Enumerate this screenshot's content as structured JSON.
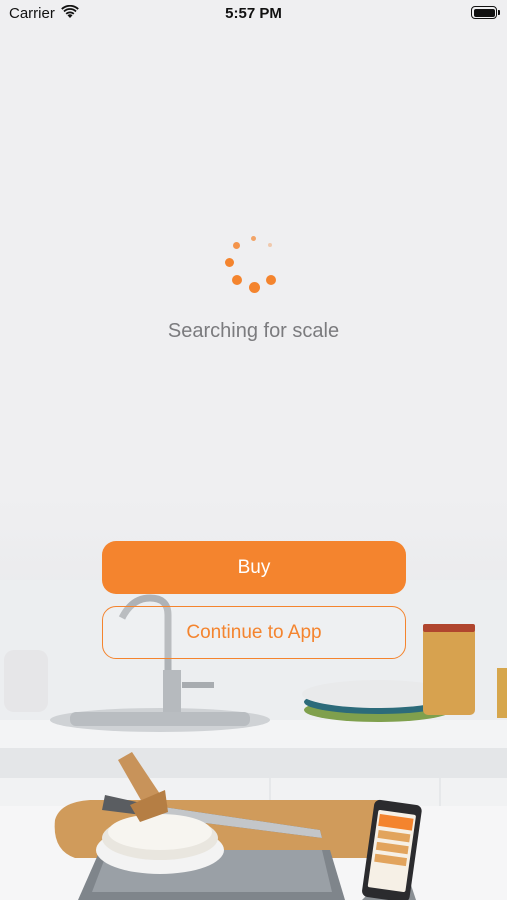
{
  "status_bar": {
    "carrier": "Carrier",
    "time": "5:57 PM",
    "icons": [
      "wifi-icon",
      "battery-icon"
    ]
  },
  "main": {
    "status_text": "Searching for scale",
    "spinner": "loading-spinner"
  },
  "actions": {
    "buy_label": "Buy",
    "continue_label": "Continue to App"
  },
  "colors": {
    "accent": "#f4842e",
    "background": "#efeff1",
    "status_text": "#7b7b7e"
  }
}
